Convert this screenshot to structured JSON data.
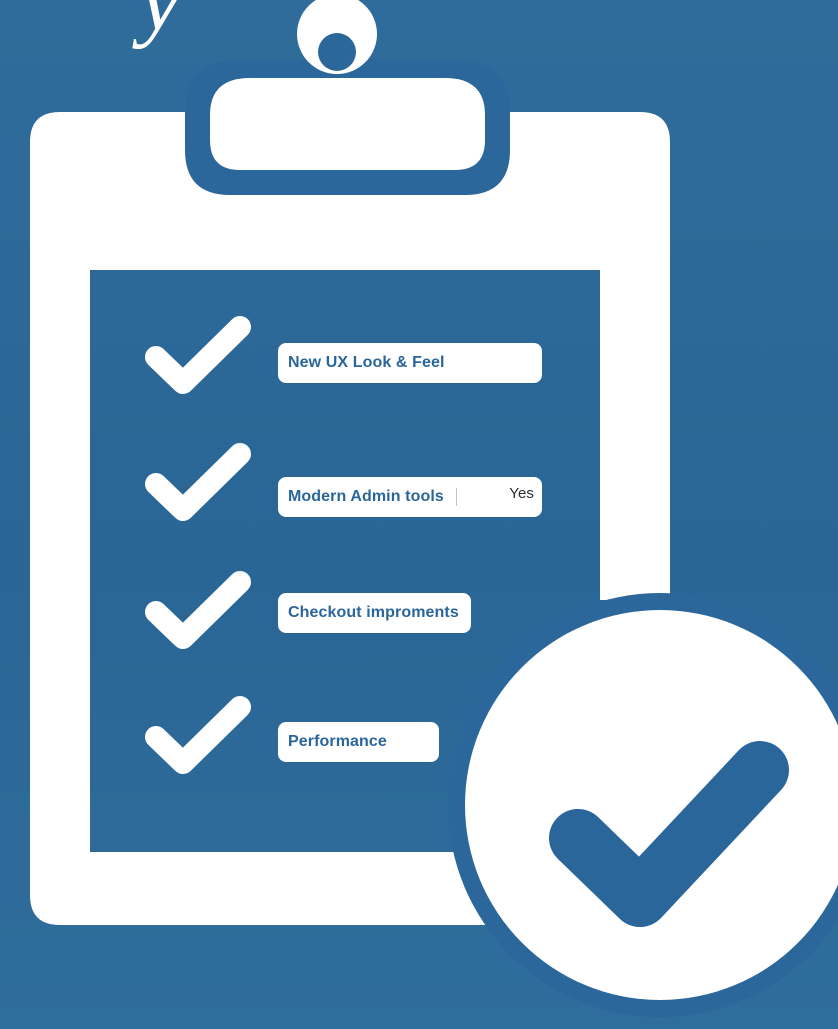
{
  "top_text_fragment": "y",
  "checklist": {
    "items": [
      {
        "label": "New UX Look & Feel",
        "value": ""
      },
      {
        "label": "Modern Admin tools",
        "value": "Yes"
      },
      {
        "label": "Checkout improments",
        "value": ""
      },
      {
        "label": "Performance",
        "value": ""
      }
    ]
  },
  "colors": {
    "background": "#2b679a",
    "clipboard": "#ffffff",
    "accent": "#2b669a"
  },
  "icons": {
    "row_check": "checkmark-icon",
    "badge": "check-circle-icon",
    "clip": "clipboard-clip-icon"
  }
}
